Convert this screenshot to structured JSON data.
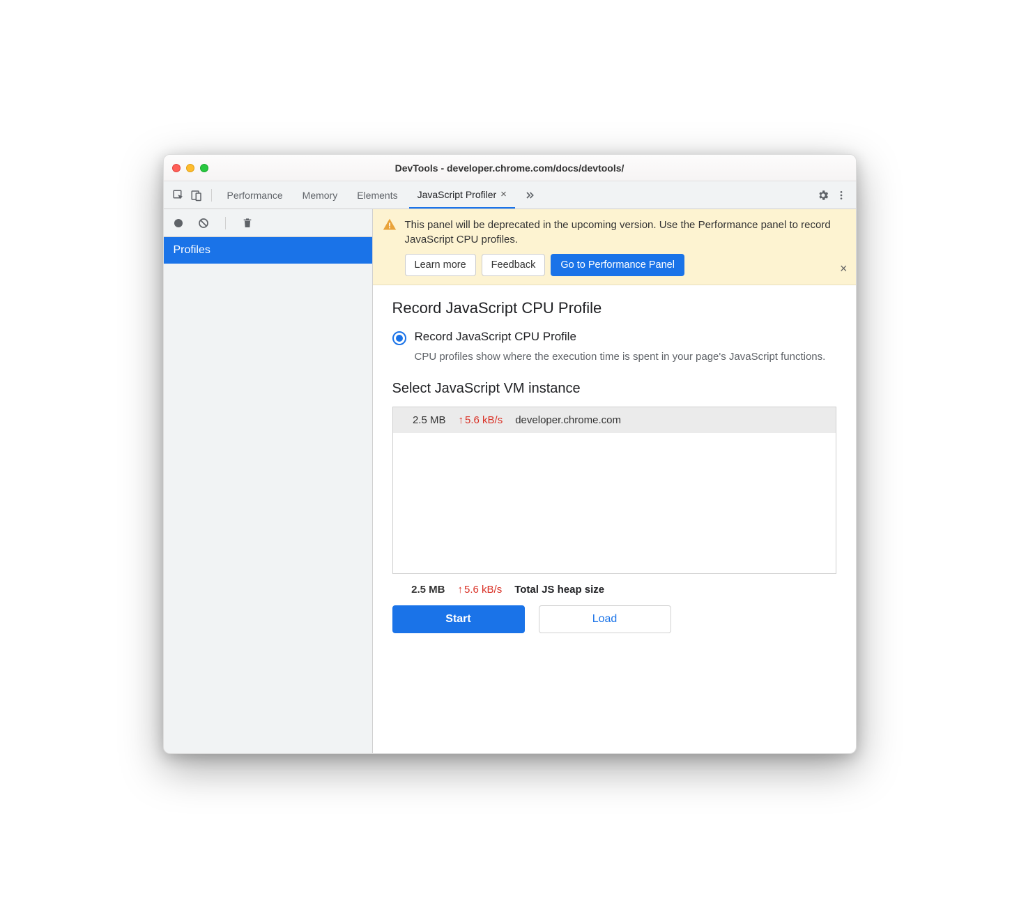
{
  "window": {
    "title": "DevTools - developer.chrome.com/docs/devtools/"
  },
  "tabs": {
    "items": [
      "Performance",
      "Memory",
      "Elements",
      "JavaScript Profiler"
    ],
    "activeIndex": 3
  },
  "sidebar": {
    "selected": "Profiles"
  },
  "banner": {
    "text": "This panel will be deprecated in the upcoming version. Use the Performance panel to record JavaScript CPU profiles.",
    "learn_more": "Learn more",
    "feedback": "Feedback",
    "go_perf": "Go to Performance Panel"
  },
  "profile": {
    "heading": "Record JavaScript CPU Profile",
    "radio_label": "Record JavaScript CPU Profile",
    "radio_desc": "CPU profiles show where the execution time is spent in your page's JavaScript functions."
  },
  "vm": {
    "heading": "Select JavaScript VM instance",
    "rows": [
      {
        "size": "2.5 MB",
        "rate": "5.6 kB/s",
        "host": "developer.chrome.com"
      }
    ],
    "total_size": "2.5 MB",
    "total_rate": "5.6 kB/s",
    "total_label": "Total JS heap size"
  },
  "actions": {
    "start": "Start",
    "load": "Load"
  }
}
